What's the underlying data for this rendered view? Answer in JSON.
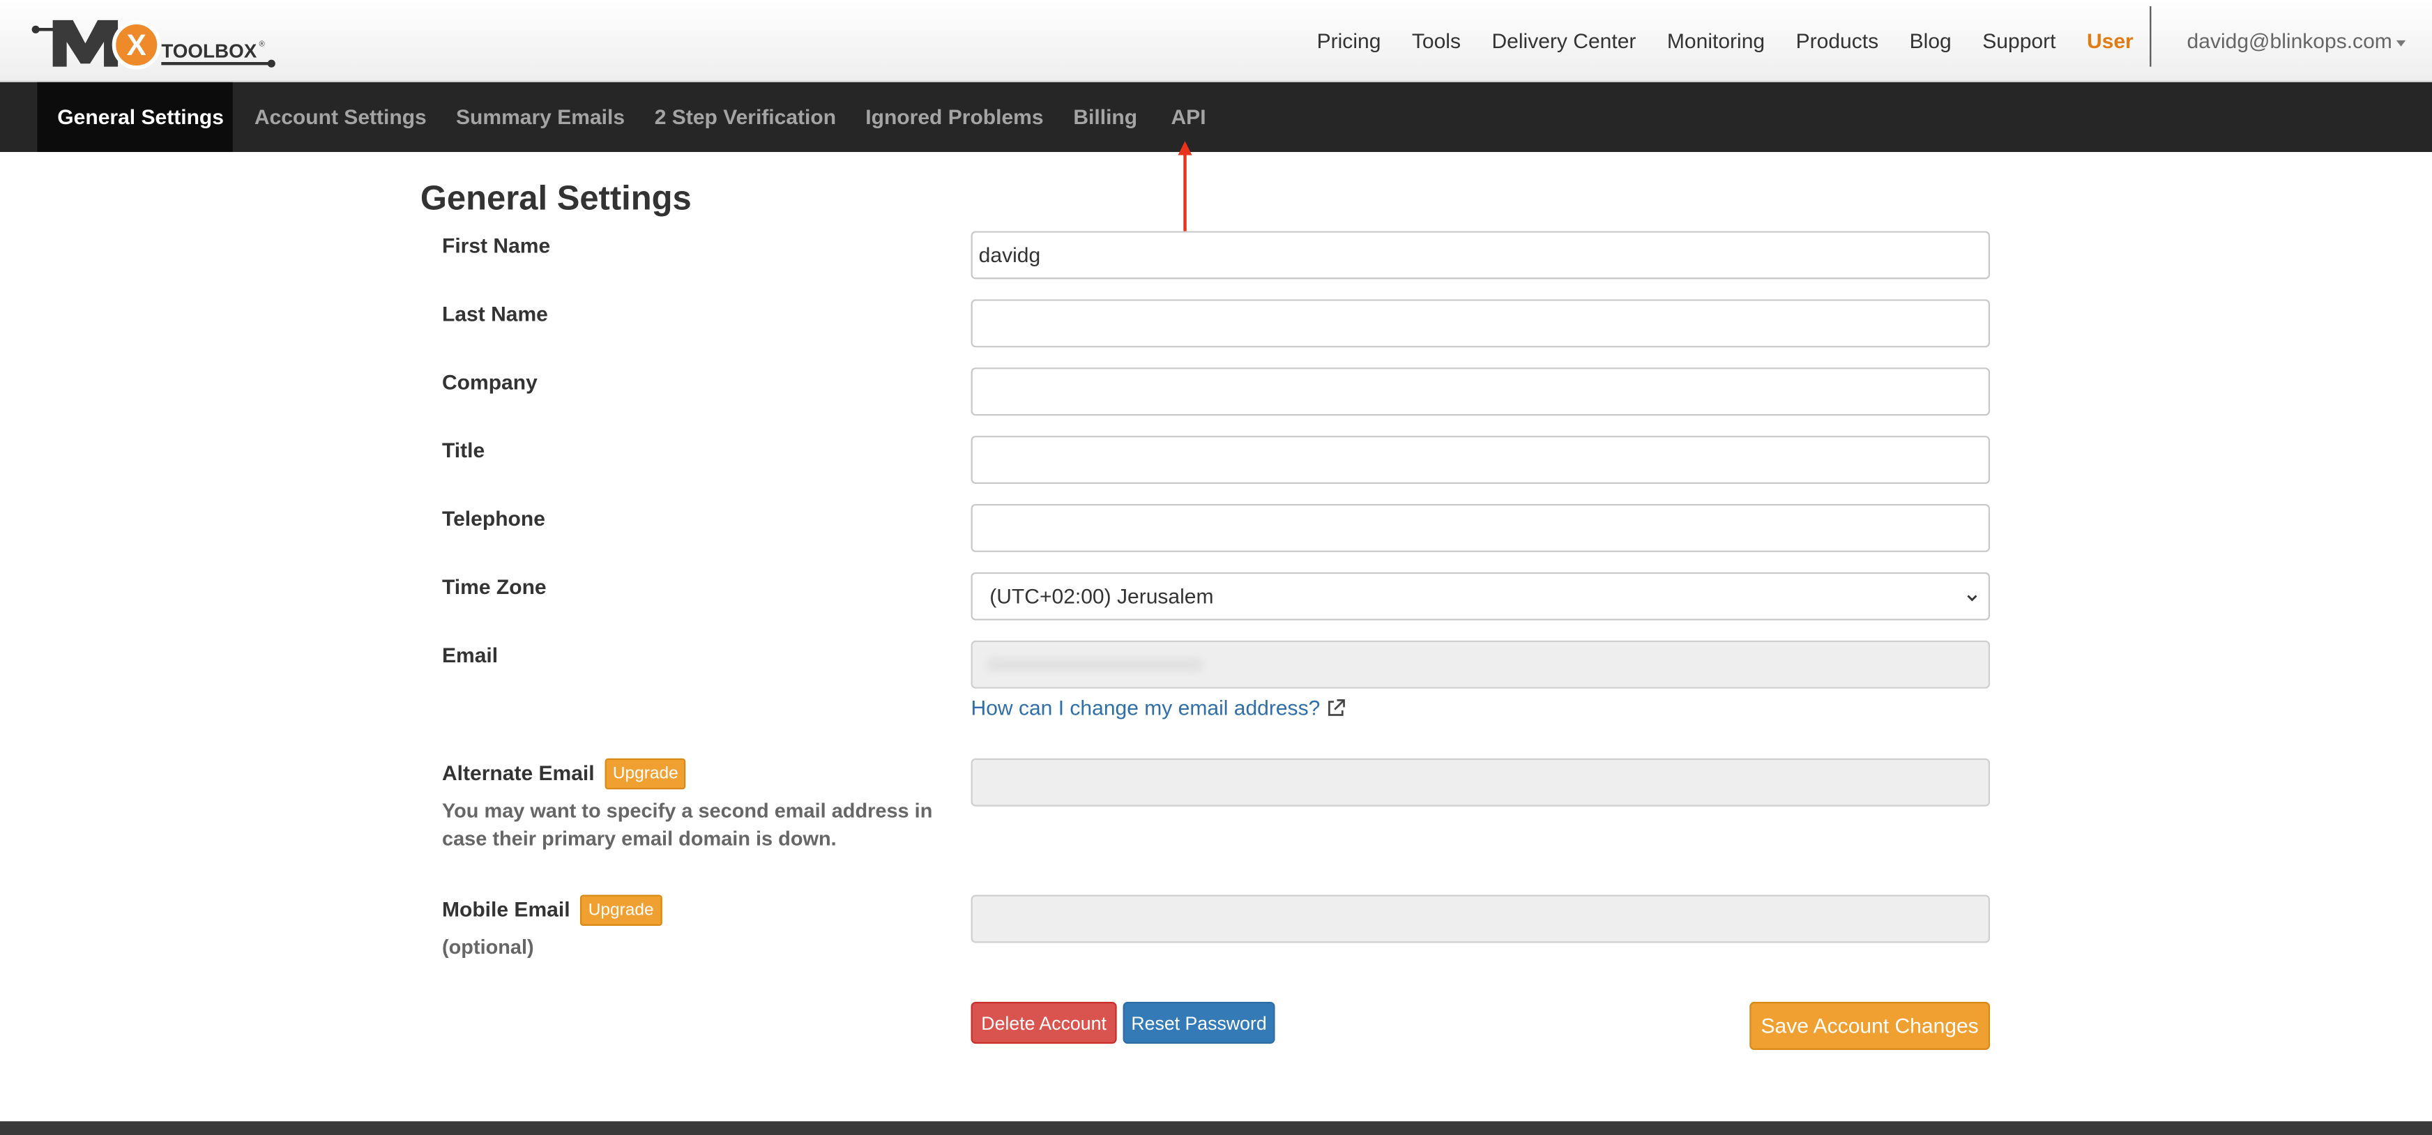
{
  "brand": {
    "logo_text": "MX TOOLBOX",
    "accent": "#e07c12"
  },
  "topnav": {
    "items": [
      "Pricing",
      "Tools",
      "Delivery Center",
      "Monitoring",
      "Products",
      "Blog",
      "Support",
      "User"
    ],
    "account": "davidg@blinkops.com"
  },
  "subnav": {
    "tabs": [
      "General Settings",
      "Account Settings",
      "Summary Emails",
      "2 Step Verification",
      "Ignored Problems",
      "Billing",
      "API"
    ],
    "active": "General Settings"
  },
  "page": {
    "title": "General Settings"
  },
  "form": {
    "first_name": {
      "label": "First Name",
      "value": "davidg"
    },
    "last_name": {
      "label": "Last Name",
      "value": ""
    },
    "company": {
      "label": "Company",
      "value": ""
    },
    "title": {
      "label": "Title",
      "value": ""
    },
    "telephone": {
      "label": "Telephone",
      "value": ""
    },
    "time_zone": {
      "label": "Time Zone",
      "value": "(UTC+02:00) Jerusalem"
    },
    "email": {
      "label": "Email",
      "value": "",
      "help_link": "How can I change my email address?"
    },
    "alternate_email": {
      "label": "Alternate Email",
      "badge": "Upgrade",
      "help": "You may want to specify a second email address in case their primary email domain is down."
    },
    "mobile_email": {
      "label": "Mobile Email",
      "badge": "Upgrade",
      "help": "(optional)"
    }
  },
  "buttons": {
    "delete": "Delete Account",
    "reset": "Reset Password",
    "save": "Save Account Changes"
  },
  "colors": {
    "subnav_bg": "#262626",
    "upgrade": "#f0a030",
    "danger": "#d9534f",
    "primary": "#337ab7",
    "annotation_arrow": "#e8321e"
  }
}
